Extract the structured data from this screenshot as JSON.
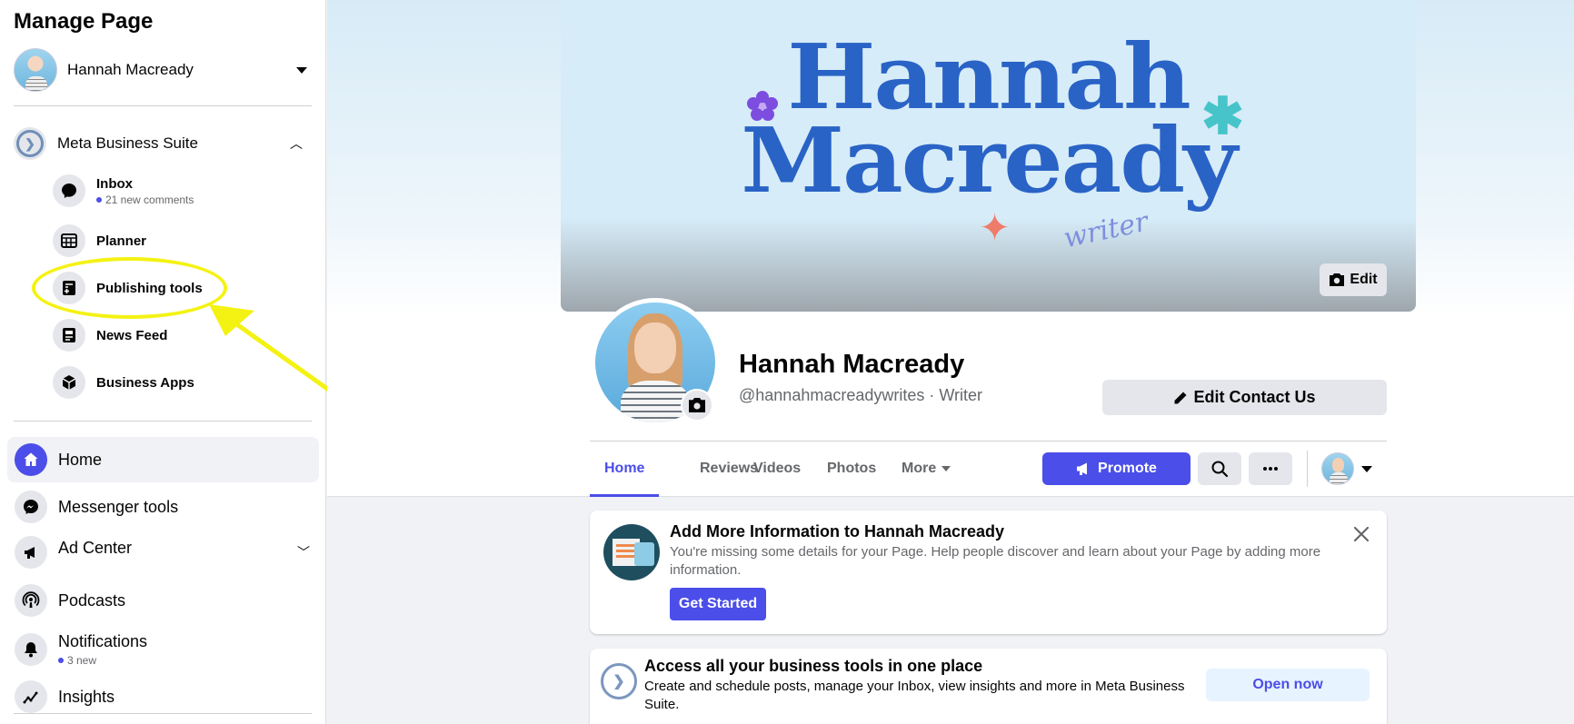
{
  "sidebar": {
    "title": "Manage Page",
    "account_name": "Hannah Macready",
    "business_suite_label": "Meta Business Suite",
    "sub_items": [
      {
        "label": "Inbox",
        "meta": "21 new comments"
      },
      {
        "label": "Planner"
      },
      {
        "label": "Publishing tools"
      },
      {
        "label": "News Feed"
      },
      {
        "label": "Business Apps"
      }
    ],
    "main_items": [
      {
        "label": "Home"
      },
      {
        "label": "Messenger tools"
      },
      {
        "label": "Ad Center"
      },
      {
        "label": "Podcasts"
      },
      {
        "label": "Notifications",
        "meta": "3 new"
      },
      {
        "label": "Insights"
      }
    ]
  },
  "annotation": {
    "highlight_color": "#f4f213"
  },
  "cover": {
    "title": "Hannah Macready",
    "subtitle": "writer",
    "edit_label": "Edit"
  },
  "profile": {
    "name": "Hannah Macready",
    "handle": "@hannahmacreadywrites · Writer",
    "edit_contact_label": "Edit Contact Us"
  },
  "tabs": [
    "Home",
    "Reviews",
    "Videos",
    "Photos",
    "More"
  ],
  "actions": {
    "promote_label": "Promote"
  },
  "info_card": {
    "title": "Add More Information to Hannah Macready",
    "description": "You're missing some details for your Page. Help people discover and learn about your Page by adding more information.",
    "button_label": "Get Started"
  },
  "mbs_card": {
    "title": "Access all your business tools in one place",
    "description": "Create and schedule posts, manage your Inbox, view insights and more in Meta Business Suite.",
    "button_label": "Open now"
  },
  "colors": {
    "accent": "#4b4ee8",
    "highlight": "#f4f213",
    "cover_text": "#2a63c6"
  }
}
